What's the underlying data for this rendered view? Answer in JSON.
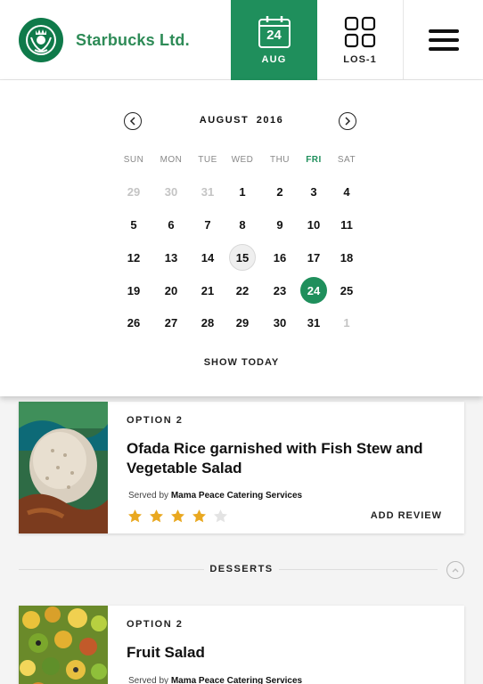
{
  "header": {
    "brand_name": "Starbucks Ltd.",
    "date_day": "24",
    "date_month": "AUG",
    "los_label": "LOS-1",
    "brand_color": "#1f8f5c",
    "icons": {
      "logo": "starbucks-logo",
      "calendar": "calendar-icon",
      "grid": "grid-icon",
      "menu": "hamburger-menu-icon"
    }
  },
  "calendar": {
    "month": "AUGUST",
    "year": "2016",
    "weekdays": [
      "SUN",
      "MON",
      "TUE",
      "WED",
      "THU",
      "FRI",
      "SAT"
    ],
    "current_weekday": "FRI",
    "weeks": [
      [
        {
          "d": "29",
          "m": true
        },
        {
          "d": "30",
          "m": true
        },
        {
          "d": "31",
          "m": true
        },
        {
          "d": "1"
        },
        {
          "d": "2"
        },
        {
          "d": "3"
        },
        {
          "d": "4"
        }
      ],
      [
        {
          "d": "5"
        },
        {
          "d": "6"
        },
        {
          "d": "7"
        },
        {
          "d": "8"
        },
        {
          "d": "9"
        },
        {
          "d": "10"
        },
        {
          "d": "11"
        }
      ],
      [
        {
          "d": "12"
        },
        {
          "d": "13"
        },
        {
          "d": "14"
        },
        {
          "d": "15",
          "today": true
        },
        {
          "d": "16"
        },
        {
          "d": "17"
        },
        {
          "d": "18"
        }
      ],
      [
        {
          "d": "19"
        },
        {
          "d": "20"
        },
        {
          "d": "21"
        },
        {
          "d": "22"
        },
        {
          "d": "23"
        },
        {
          "d": "24",
          "selected": true
        },
        {
          "d": "25"
        }
      ],
      [
        {
          "d": "26"
        },
        {
          "d": "27"
        },
        {
          "d": "28"
        },
        {
          "d": "29"
        },
        {
          "d": "30"
        },
        {
          "d": "31"
        },
        {
          "d": "1",
          "m": true
        }
      ]
    ],
    "show_today_label": "SHOW TODAY",
    "prev_icon": "chevron-left-icon",
    "next_icon": "chevron-right-icon"
  },
  "meal_option": {
    "option_label": "OPTION 2",
    "title": "Ofada Rice garnished with Fish Stew and Vegetable Salad",
    "served_prefix": "Served by",
    "caterer": "Mama Peace Catering Services",
    "rating": 4,
    "rating_max": 5,
    "add_review_label": "ADD REVIEW"
  },
  "desserts_section": {
    "label": "DESSERTS",
    "toggle_icon": "chevron-up-icon"
  },
  "dessert_option": {
    "option_label": "OPTION 2",
    "title": "Fruit Salad",
    "served_prefix": "Served by",
    "caterer": "Mama Peace Catering Services"
  }
}
